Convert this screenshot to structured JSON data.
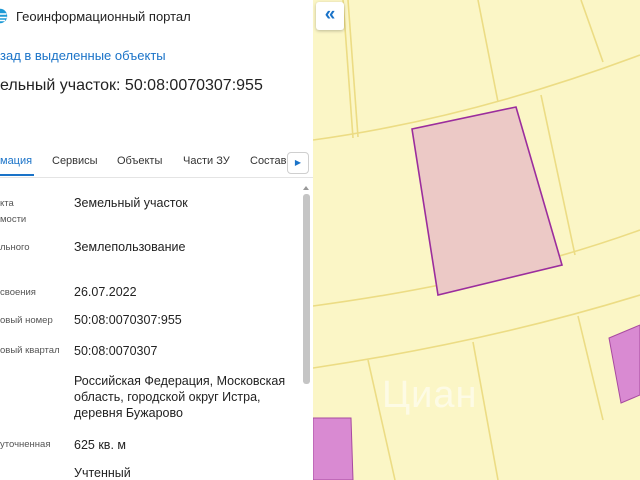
{
  "header": {
    "brand_name": "Геоинформационный портал"
  },
  "back_link": "зад в выделенные объекты",
  "object_title": "ельный участок: 50:08:0070307:955",
  "tabs": [
    {
      "label": "мация",
      "active": true
    },
    {
      "label": "Сервисы"
    },
    {
      "label": "Объекты"
    },
    {
      "label": "Части ЗУ"
    },
    {
      "label": "Состав"
    }
  ],
  "tab_next_icon": "chevron-right-icon",
  "properties": [
    {
      "label_lines": [
        "кта",
        "мости"
      ],
      "value": "Земельный участок"
    },
    {
      "label_lines": [
        "льного"
      ],
      "value": "Землепользование"
    },
    {
      "label_lines": [
        "своения"
      ],
      "value": "26.07.2022"
    },
    {
      "label_lines": [
        "овый номер"
      ],
      "value": "50:08:0070307:955"
    },
    {
      "label_lines": [
        "овый квартал"
      ],
      "value": "50:08:0070307"
    },
    {
      "label_lines": [],
      "value": "Российская Федерация, Московская область, городской округ Истра, деревня Бужарово"
    },
    {
      "label_lines": [
        "уточненная"
      ],
      "value": "625 кв. м"
    },
    {
      "label_lines": [],
      "value": "Учтенный"
    }
  ],
  "map": {
    "collapse_icon": "double-chevron-left-icon",
    "collapse_glyph": "«",
    "watermark": "Циан",
    "colors": {
      "background": "#fbf6c6",
      "boundary": "#ecdc84",
      "selected_fill": "#ecc9c6",
      "selected_stroke": "#9b2d9d",
      "neighbor_fill": "#d98ad2"
    }
  }
}
